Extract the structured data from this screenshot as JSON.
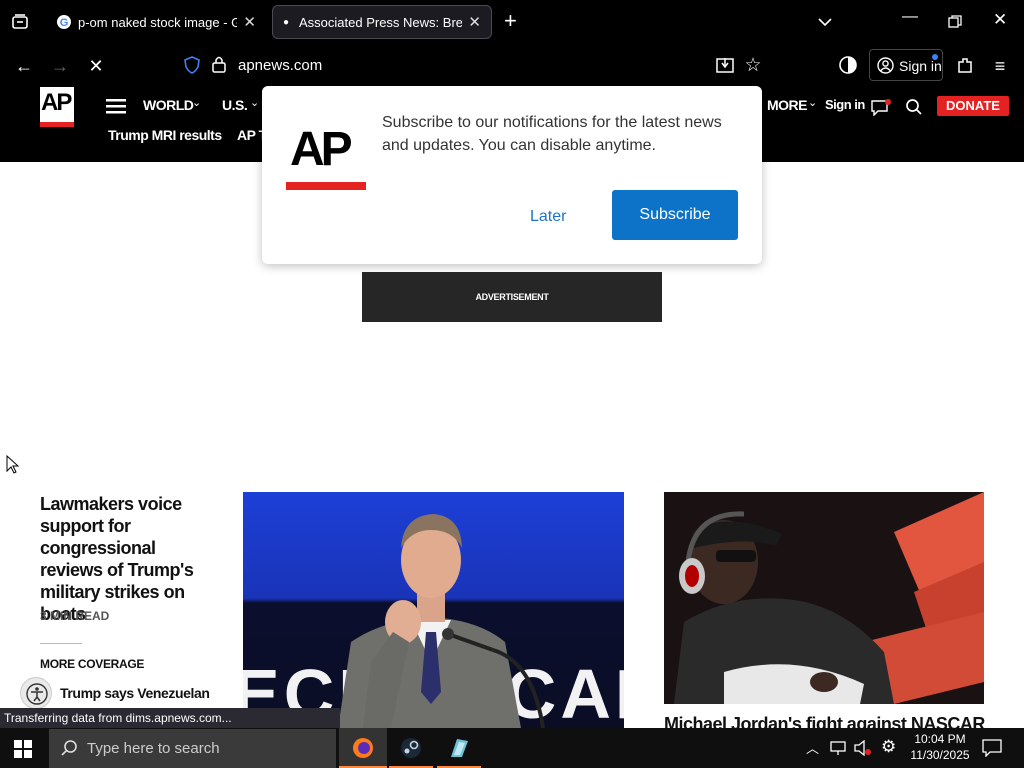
{
  "browser": {
    "tabs": [
      {
        "label": "p-om naked stock image - Goo",
        "active": false
      },
      {
        "label": "Associated Press News: Breakin",
        "active": true
      }
    ],
    "url": "apnews.com",
    "sign_in": "Sign in",
    "status_text": "Transferring data from dims.apnews.com..."
  },
  "site_header": {
    "logo": "AP",
    "nav": [
      "WORLD",
      "U.S.",
      "MORE"
    ],
    "sign_in": "Sign in",
    "donate": "DONATE",
    "subnav": [
      "Trump MRI results",
      "AP T"
    ]
  },
  "popup": {
    "logo": "AP",
    "message": "Subscribe to our notifications for the latest news and updates. You can disable anytime.",
    "later": "Later",
    "subscribe": "Subscribe"
  },
  "ad": {
    "label": "ADVERTISEMENT"
  },
  "lead_story": {
    "headline": "Lawmakers voice support for congressional reviews of Trump's military strikes on boats",
    "read_time": "3 MIN READ",
    "more_coverage": "MORE COVERAGE",
    "sub_headline": "Trump says Venezuelan"
  },
  "image1": {
    "backdrop_text": "ECHNOCAR"
  },
  "second_story": {
    "headline": "Michael Jordan's fight against NASCAR"
  },
  "taskbar": {
    "search_placeholder": "Type here to search",
    "time": "10:04 PM",
    "date": "11/30/2025"
  },
  "colors": {
    "ap_red": "#e52222",
    "subscribe_blue": "#0d73c8",
    "header_black": "#000000"
  }
}
